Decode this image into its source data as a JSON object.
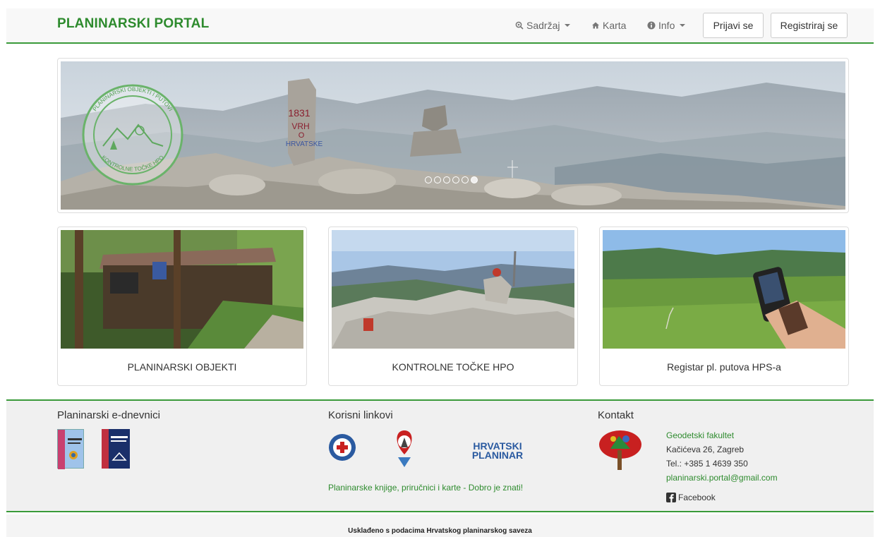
{
  "navbar": {
    "brand": "PLANINARSKI PORTAL",
    "items": [
      {
        "label": "Sadržaj",
        "icon": "search-icon",
        "dropdown": true
      },
      {
        "label": "Karta",
        "icon": "home-icon",
        "dropdown": false
      },
      {
        "label": "Info",
        "icon": "info-icon",
        "dropdown": true
      }
    ],
    "login_label": "Prijavi se",
    "register_label": "Registriraj se"
  },
  "banner": {
    "logo_text_top": "PLANINARSKI OBJEKTI I PUTOVI",
    "logo_text_bottom": "KONTROLNE TOČKE HPO",
    "stone_text": [
      "1831",
      "VRH",
      "O",
      "HRVATSKE"
    ],
    "carousel_slides": 6,
    "active_slide": 6
  },
  "cards": [
    {
      "label": "PLANINARSKI OBJEKTI"
    },
    {
      "label": "KONTROLNE TOČKE HPO"
    },
    {
      "label": "Registar pl. putova HPS-a"
    }
  ],
  "footer": {
    "col1_title": "Planinarski e-dnevnici",
    "col2_title": "Korisni linkovi",
    "col2_link": "Planinarske knjige, priručnici i karte - Dobro je znati!",
    "hrvatski_planinar_line1": "HRVATSKI",
    "hrvatski_planinar_line2": "PLANINAR",
    "col3_title": "Kontakt",
    "org_name": "Geodetski fakultet",
    "address": "Kačićeva 26, Zagreb",
    "phone": "Tel.: +385 1 4639 350",
    "email": "planinarski.portal@gmail.com",
    "facebook": "Facebook"
  },
  "bottom_note": "Usklađeno s podacima Hrvatskog planinarskog saveza",
  "colors": {
    "accent": "#2e8b2e",
    "border": "#3a9a3a"
  }
}
